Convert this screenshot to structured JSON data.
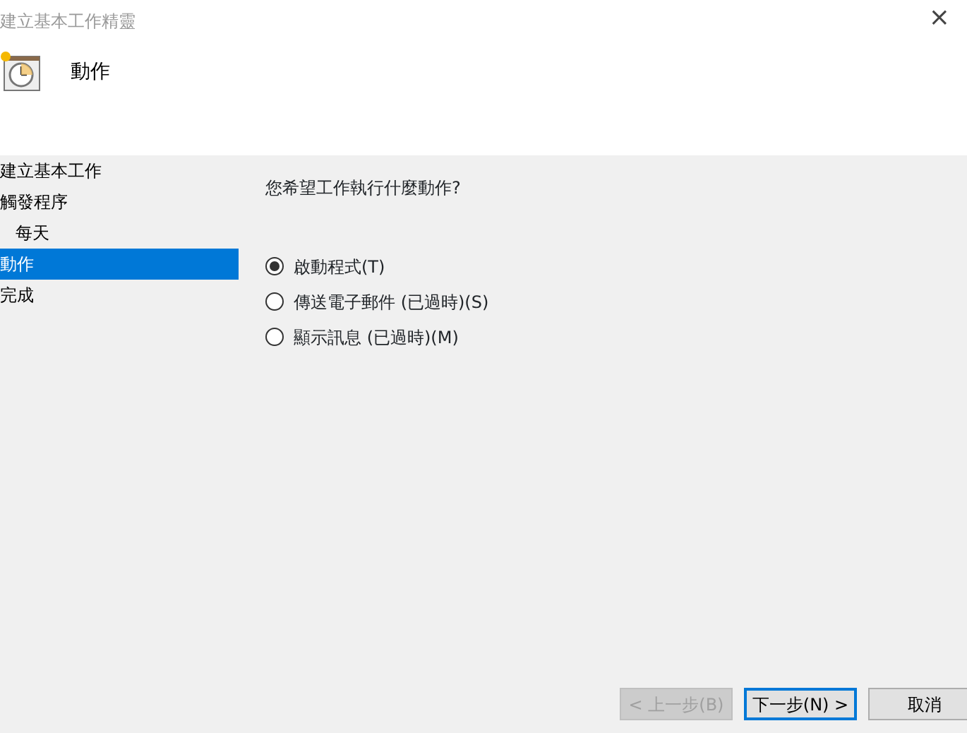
{
  "window": {
    "title": "建立基本工作精靈",
    "close": "×"
  },
  "header": {
    "title": "動作"
  },
  "sidebar": {
    "items": [
      {
        "label": "建立基本工作",
        "selected": false
      },
      {
        "label": "觸發程序",
        "selected": false,
        "children": [
          {
            "label": "每天",
            "selected": false
          }
        ]
      },
      {
        "label": "動作",
        "selected": true
      },
      {
        "label": "完成",
        "selected": false
      }
    ]
  },
  "question": "您希望工作執行什麼動作?",
  "options": [
    {
      "label": "啟動程式(T)",
      "selected": true
    },
    {
      "label": "傳送電子郵件 (已過時)(S)",
      "selected": false
    },
    {
      "label": "顯示訊息 (已過時)(M)",
      "selected": false
    }
  ],
  "buttons": [
    {
      "label": "< 上一步(B)",
      "disabled": true,
      "default": false
    },
    {
      "label": "下一步(N) >",
      "disabled": false,
      "default": true
    },
    {
      "label": "取消",
      "disabled": false,
      "default": false
    }
  ]
}
